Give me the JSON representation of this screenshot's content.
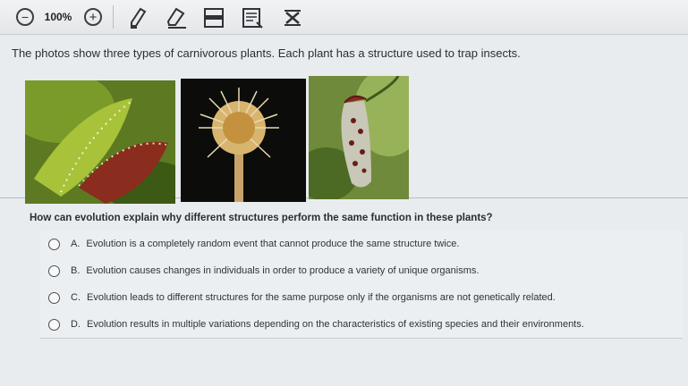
{
  "toolbar": {
    "zoom_out_symbol": "−",
    "zoom_level": "100%",
    "zoom_in_symbol": "+",
    "tools": [
      {
        "name": "pencil-icon"
      },
      {
        "name": "eraser-icon"
      },
      {
        "name": "line-reader-icon"
      },
      {
        "name": "reference-sheet-icon"
      },
      {
        "name": "answer-eliminator-icon"
      }
    ]
  },
  "prompt": "The photos show three types of carnivorous plants. Each plant has a structure used to trap insects.",
  "photos": [
    {
      "name": "venus-flytrap-photo"
    },
    {
      "name": "sundew-photo"
    },
    {
      "name": "pitcher-plant-photo"
    }
  ],
  "question": "How can evolution explain why different structures perform the same function in these plants?",
  "choices": [
    {
      "letter": "A.",
      "text": "Evolution is a completely random event that cannot produce the same structure twice."
    },
    {
      "letter": "B.",
      "text": "Evolution causes changes in individuals in order to produce a variety of unique organisms."
    },
    {
      "letter": "C.",
      "text": "Evolution leads to different structures for the same purpose only if the organisms are not genetically related."
    },
    {
      "letter": "D.",
      "text": "Evolution results in multiple variations depending on the characteristics of existing species and their environments."
    }
  ],
  "colors": {
    "toolbar_bg": "#e4e6e8",
    "page_bg": "#e9ecee",
    "text": "#2a2e33"
  }
}
